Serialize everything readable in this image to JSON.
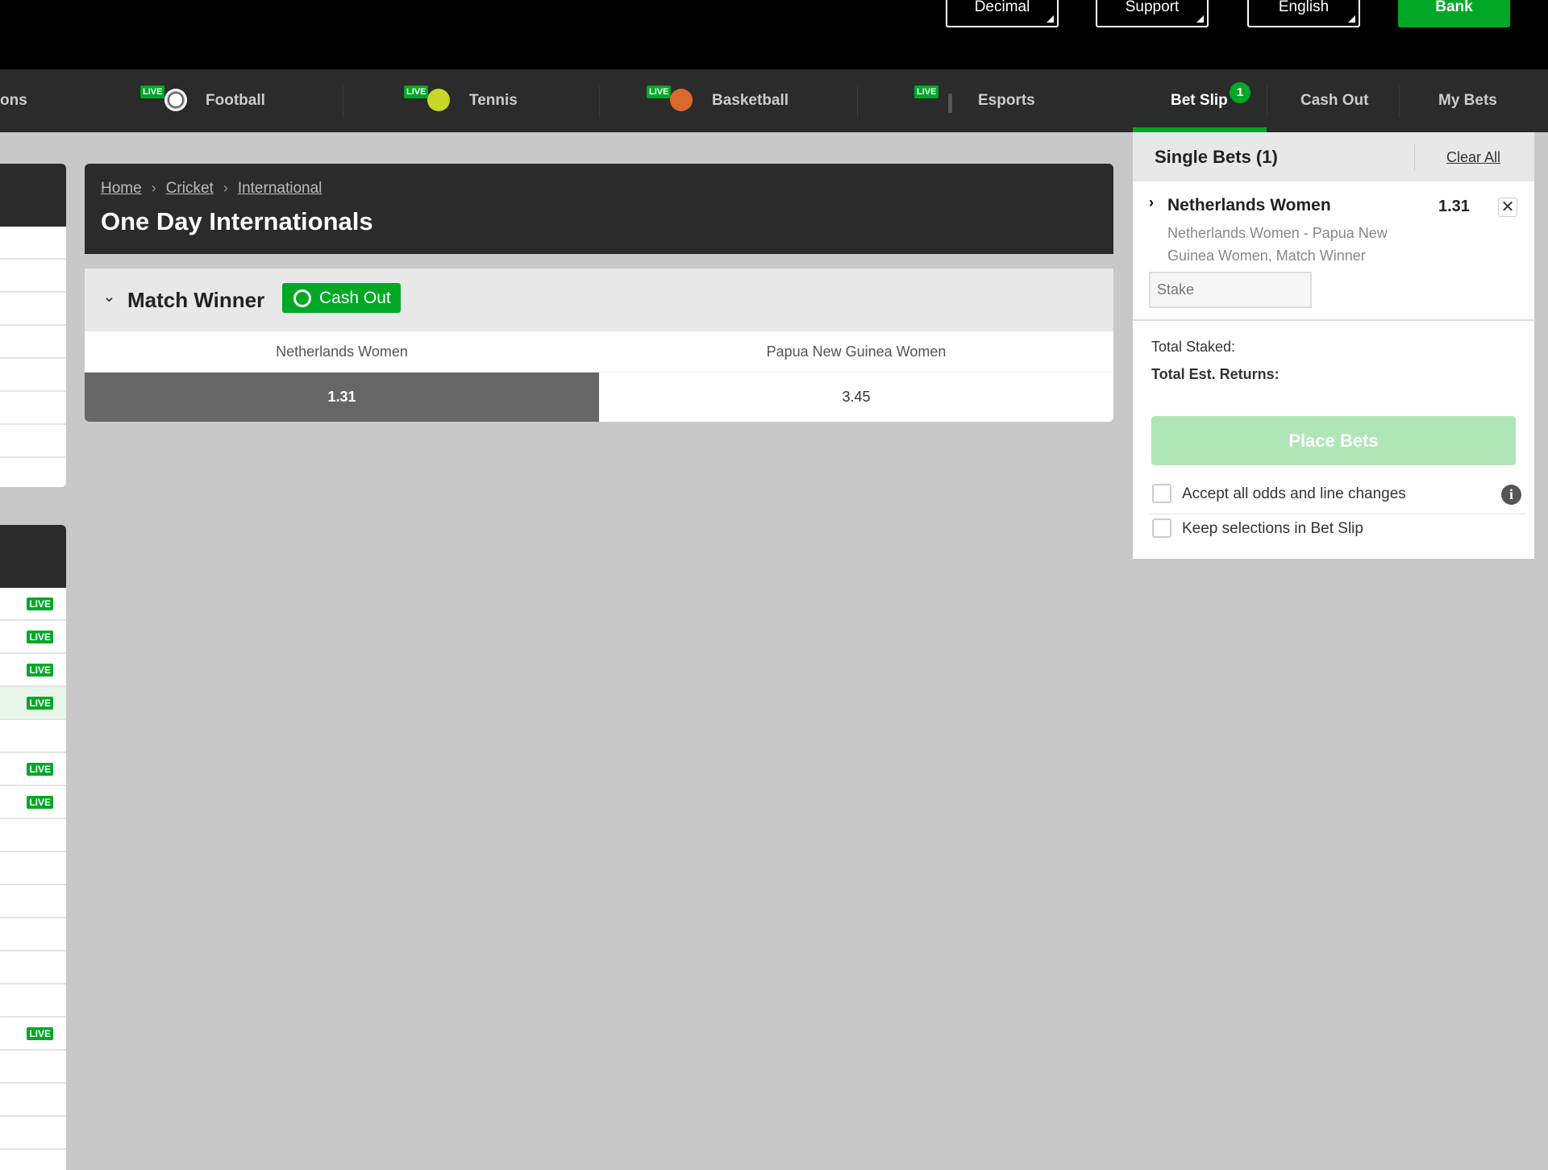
{
  "topbar": {
    "odds_format": "Decimal",
    "support": "Support",
    "language": "English",
    "bank": "Bank"
  },
  "nav": {
    "partial_item": "ons",
    "live_badge": "LIVE",
    "items": [
      {
        "label": "Football",
        "icon": "football-icon"
      },
      {
        "label": "Tennis",
        "icon": "tennis-ball-icon"
      },
      {
        "label": "Basketball",
        "icon": "basketball-icon"
      },
      {
        "label": "Esports",
        "icon": "esports-icon"
      }
    ],
    "bet_slip": "Bet Slip",
    "bet_slip_count": "1",
    "cash_out": "Cash Out",
    "my_bets": "My Bets"
  },
  "sidebar": {
    "live_badge": "LIVE",
    "panel2_live_rows": [
      true,
      true,
      true,
      true,
      false,
      true,
      true,
      false,
      false,
      false,
      false,
      false,
      false,
      true,
      false,
      false,
      false
    ]
  },
  "main": {
    "breadcrumb": [
      "Home",
      "Cricket",
      "International"
    ],
    "title": "One Day Internationals",
    "market": {
      "name": "Match Winner",
      "cash_out": "Cash Out",
      "teams": [
        "Netherlands Women",
        "Papua New Guinea Women"
      ],
      "odds": [
        "1.31",
        "3.45"
      ],
      "selected": 0
    }
  },
  "betslip": {
    "title": "Single Bets (1)",
    "clear_all": "Clear All",
    "selection": {
      "name": "Netherlands Women",
      "odds": "1.31",
      "description": "Netherlands Women - Papua New Guinea Women, Match Winner",
      "stake_placeholder": "Stake"
    },
    "total_staked": "Total Staked:",
    "total_returns": "Total Est. Returns:",
    "place_bets": "Place Bets",
    "accept_odds": "Accept all odds and line changes",
    "keep_selections": "Keep selections in Bet Slip"
  },
  "colors": {
    "brand": "#00a826",
    "dark": "#2b2b2b",
    "selected_odds": "#666666"
  }
}
